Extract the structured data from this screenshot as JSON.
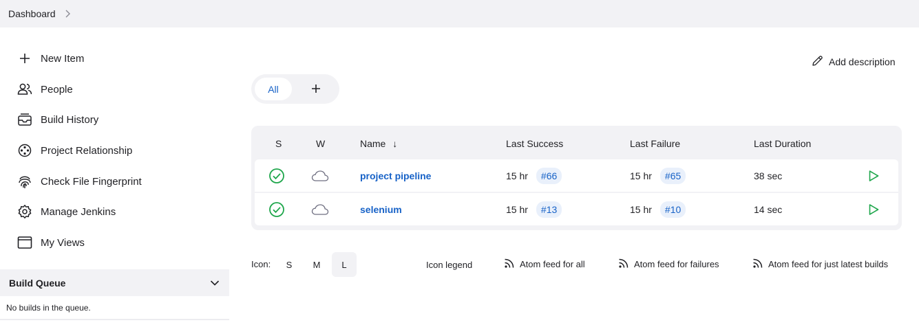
{
  "breadcrumb": {
    "items": [
      "Dashboard"
    ]
  },
  "sidebar": {
    "items": [
      {
        "label": "New Item",
        "icon": "plus-icon"
      },
      {
        "label": "People",
        "icon": "people-icon"
      },
      {
        "label": "Build History",
        "icon": "inbox-icon"
      },
      {
        "label": "Project Relationship",
        "icon": "relationship-icon"
      },
      {
        "label": "Check File Fingerprint",
        "icon": "fingerprint-icon"
      },
      {
        "label": "Manage Jenkins",
        "icon": "gear-icon"
      },
      {
        "label": "My Views",
        "icon": "window-icon"
      }
    ]
  },
  "build_queue": {
    "title": "Build Queue",
    "empty_text": "No builds in the queue."
  },
  "main": {
    "add_description": "Add description",
    "tabs": [
      {
        "label": "All",
        "active": true
      }
    ]
  },
  "table": {
    "headers": {
      "status": "S",
      "weather": "W",
      "name": "Name",
      "sort_indicator": "↓",
      "last_success": "Last Success",
      "last_failure": "Last Failure",
      "last_duration": "Last Duration"
    },
    "rows": [
      {
        "name": "project pipeline",
        "status": "success",
        "weather": "cloudy",
        "last_success_time": "15 hr",
        "last_success_build": "#66",
        "last_failure_time": "15 hr",
        "last_failure_build": "#65",
        "last_duration": "38 sec"
      },
      {
        "name": "selenium",
        "status": "success",
        "weather": "cloudy",
        "last_success_time": "15 hr",
        "last_success_build": "#13",
        "last_failure_time": "15 hr",
        "last_failure_build": "#10",
        "last_duration": "14 sec"
      }
    ]
  },
  "footer": {
    "icon_label": "Icon:",
    "sizes": [
      "S",
      "M",
      "L"
    ],
    "active_size": "L",
    "icon_legend": "Icon legend",
    "feeds": [
      "Atom feed for all",
      "Atom feed for failures",
      "Atom feed for just latest builds"
    ]
  },
  "colors": {
    "accent": "#1762c7",
    "success": "#1ea64b",
    "panel": "#f2f2f5",
    "badge_bg": "#e9f0fb"
  }
}
